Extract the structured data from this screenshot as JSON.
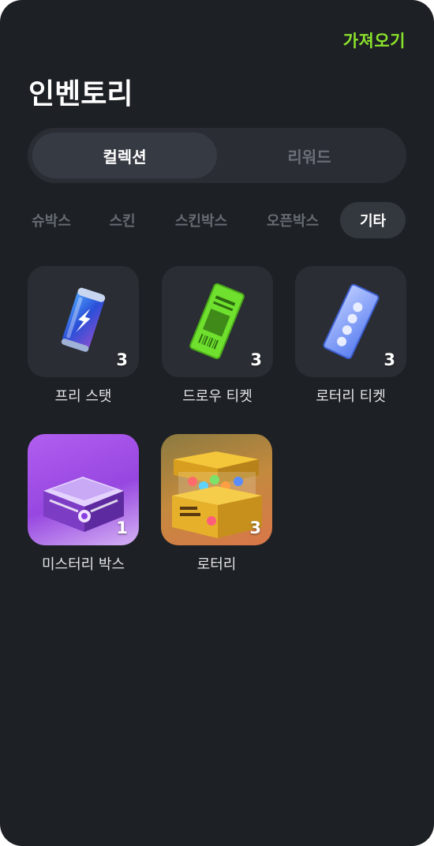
{
  "header": {
    "import_label": "가져오기",
    "title": "인벤토리"
  },
  "tabs": [
    {
      "label": "컬렉션",
      "active": true
    },
    {
      "label": "리워드",
      "active": false
    }
  ],
  "filters": [
    {
      "label": "슈박스",
      "active": false
    },
    {
      "label": "스킨",
      "active": false
    },
    {
      "label": "스킨박스",
      "active": false
    },
    {
      "label": "오픈박스",
      "active": false
    },
    {
      "label": "기타",
      "active": true
    }
  ],
  "items": [
    {
      "name": "프리 스탯",
      "count": "3",
      "icon": "energy-can-icon"
    },
    {
      "name": "드로우 티켓",
      "count": "3",
      "icon": "green-ticket-icon"
    },
    {
      "name": "로터리 티켓",
      "count": "3",
      "icon": "blue-ticket-icon"
    },
    {
      "name": "미스터리 박스",
      "count": "1",
      "icon": "mystery-box-icon"
    },
    {
      "name": "로터리",
      "count": "3",
      "icon": "lottery-machine-icon"
    }
  ],
  "colors": {
    "background": "#1d2024",
    "accent": "#8be22c",
    "tile": "#2a2d33"
  }
}
